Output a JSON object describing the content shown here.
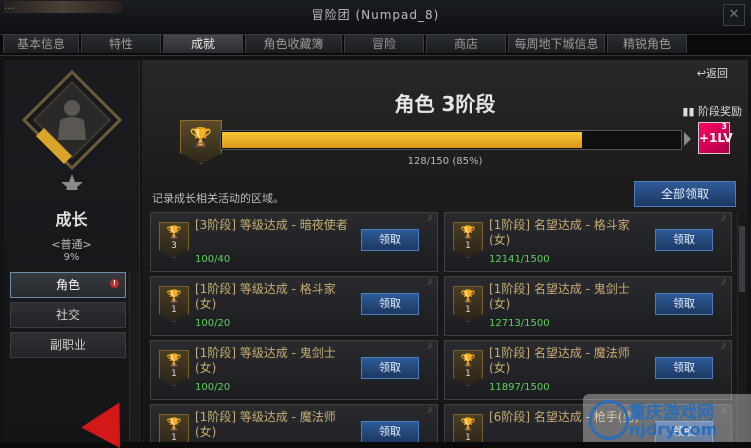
{
  "window": {
    "title": "冒险团 (Numpad_8)",
    "bg_title": "…"
  },
  "tabs": [
    {
      "label": "基本信息",
      "w": 74
    },
    {
      "label": "特性",
      "w": 78
    },
    {
      "label": "成就",
      "w": 78,
      "active": true
    },
    {
      "label": "角色收藏簿",
      "w": 95
    },
    {
      "label": "冒险",
      "w": 78
    },
    {
      "label": "商店",
      "w": 78
    },
    {
      "label": "每周地下城信息",
      "w": 95
    },
    {
      "label": "精锐角色",
      "w": 78
    }
  ],
  "sidebar": {
    "title": "成长",
    "subtitle": "<普通>",
    "percent": "9%",
    "items": [
      {
        "label": "角色",
        "active": true,
        "alert": "!"
      },
      {
        "label": "社交"
      },
      {
        "label": "副职业"
      }
    ]
  },
  "main": {
    "back": "返回",
    "stage_title": "角色 3阶段",
    "reward_label": "阶段奖励",
    "progress_text": "128/150 (85%)",
    "progress_value": 0.85,
    "lv_icon_text": "+1LV",
    "lv_icon_sup": "3",
    "desc": "记录成长相关活动的区域。",
    "claim_all": "全部领取"
  },
  "achievements": [
    {
      "name": "[3阶段] 等级达成 - 暗夜使者",
      "count": "3",
      "value": "100/40",
      "button": "领取"
    },
    {
      "name": "[1阶段] 名望达成 - 格斗家(女)",
      "count": "1",
      "value": "12141/1500",
      "button": "领取"
    },
    {
      "name": "[1阶段] 等级达成 - 格斗家(女)",
      "count": "1",
      "value": "100/20",
      "button": "领取"
    },
    {
      "name": "[1阶段] 名望达成 - 鬼剑士(女)",
      "count": "1",
      "value": "12713/1500",
      "button": "领取"
    },
    {
      "name": "[1阶段] 等级达成 - 鬼剑士(女)",
      "count": "1",
      "value": "100/20",
      "button": "领取"
    },
    {
      "name": "[1阶段] 名望达成 - 魔法师(女)",
      "count": "1",
      "value": "11897/1500",
      "button": "领取"
    },
    {
      "name": "[1阶段] 等级达成 - 魔法师(女)",
      "count": "1",
      "value": "",
      "button": "领取"
    },
    {
      "name": "[6阶段] 名望达成 - 枪手(男)",
      "count": "1",
      "value": "",
      "button": "领取"
    }
  ],
  "watermark": {
    "line1": "重庆游戏网",
    "line2": "njdry.com"
  },
  "colors": {
    "accent_gold": "#f0b928",
    "button_blue": "#2f5b97",
    "value_green": "#5bd25b",
    "alert_red": "#c0292a"
  }
}
